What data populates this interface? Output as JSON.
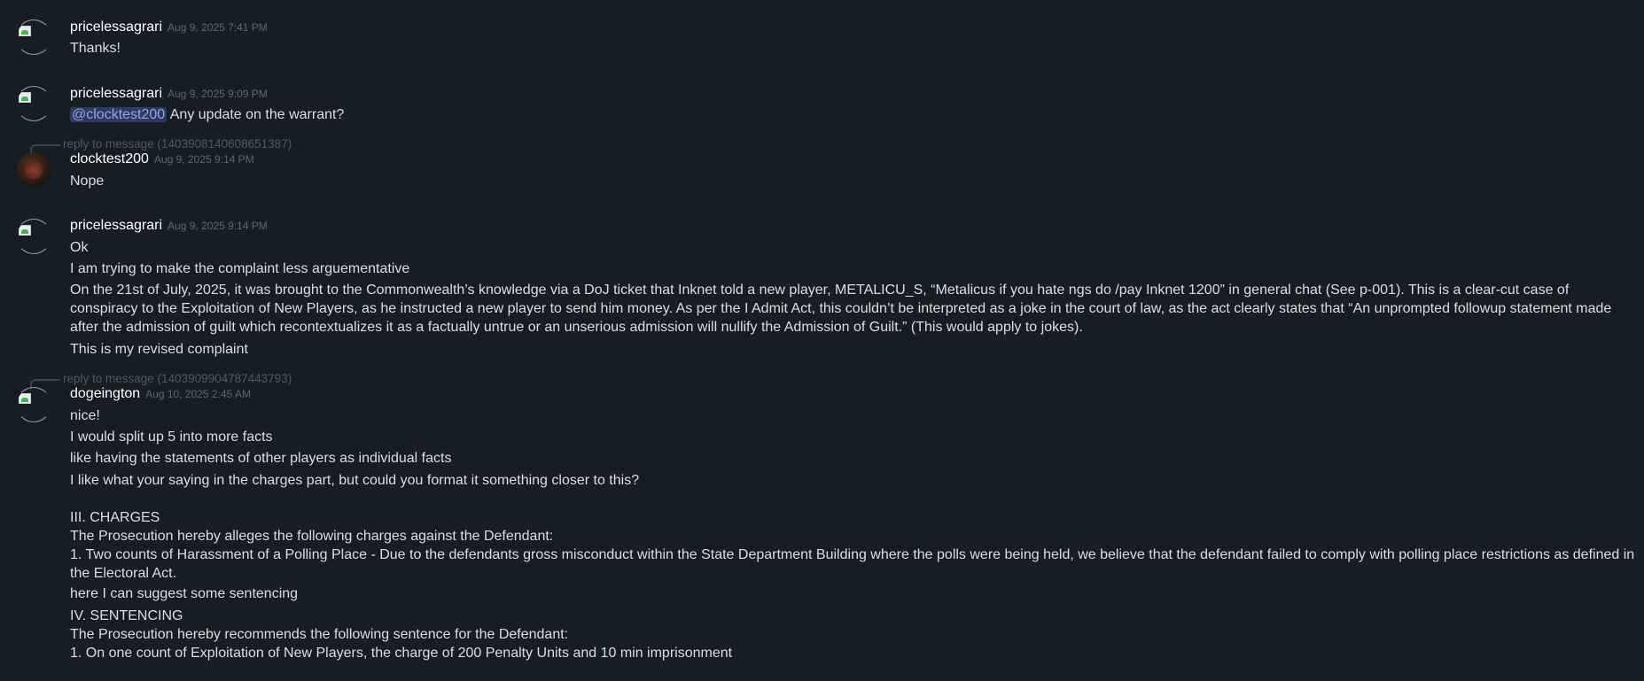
{
  "messages": [
    {
      "author": "pricelessagrari",
      "timestamp": "Aug 9, 2025 7:41 PM",
      "lines": [
        "Thanks!"
      ]
    },
    {
      "author": "pricelessagrari",
      "timestamp": "Aug 9, 2025 9:09 PM",
      "mention": "@clocktest200",
      "lines": [
        "Any update on the warrant?"
      ]
    },
    {
      "reply_to": "reply to message (1403908140608651387)",
      "author": "clocktest200",
      "timestamp": "Aug 9, 2025 9:14 PM",
      "lines": [
        "Nope"
      ]
    },
    {
      "author": "pricelessagrari",
      "timestamp": "Aug 9, 2025 9:14 PM",
      "lines": [
        "Ok",
        "I am trying to make the complaint less arguementative",
        "On the 21st of July, 2025, it was brought to the Commonwealth’s knowledge via a DoJ ticket that Inknet told a new player, METALICU_S, “Metalicus if you hate ngs do /pay Inknet 1200” in general chat (See p-001). This is a clear-cut case of conspiracy to the Exploitation of New Players, as he instructed a new player to send him money. As per the I Admit Act, this couldn’t be interpreted as a joke in the court of law, as the act clearly states that “An unprompted followup statement made after the admission of guilt which recontextualizes it as a factually untrue or an unserious admission will nullify the Admission of Guilt.” (This would apply to jokes).",
        "This is my revised complaint"
      ]
    },
    {
      "reply_to": "reply to message (1403909904787443793)",
      "author": "dogeington",
      "timestamp": "Aug 10, 2025 2:45 AM",
      "lines": [
        "nice!",
        "I would split up 5 into more facts",
        "like having the statements of other players as individual facts",
        "I like what your saying in the charges part, but could you format it something closer to this?",
        "III. CHARGES",
        "The Prosecution hereby alleges the following charges against the Defendant:",
        "1. Two counts of Harassment of a Polling Place - Due to the defendants gross misconduct within the State Department Building where the polls were being held, we believe that the defendant failed to comply with polling place restrictions as defined in the Electoral Act.",
        "here I can suggest some sentencing",
        "IV. SENTENCING",
        "The Prosecution hereby recommends the following sentence for the Defendant:",
        "1. On one count of Exploitation of New Players, the charge of 200 Penalty Units and 10 min imprisonment"
      ]
    }
  ]
}
